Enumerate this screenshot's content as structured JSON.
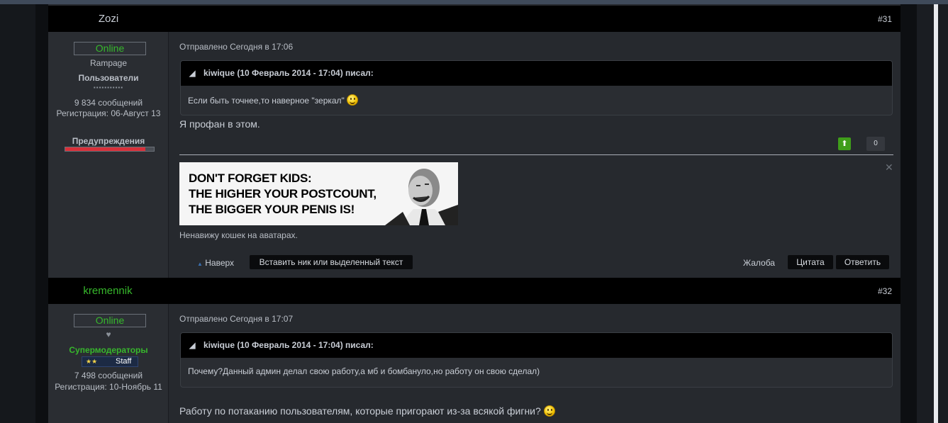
{
  "posts": [
    {
      "author": "Zozi",
      "author_color": "#c9ced6",
      "number": "#31",
      "status": "Online",
      "title": "Rampage",
      "group": "Пользователи",
      "pips": "▪▪▪▪▪▪▪▪▪▪▪",
      "messages": "9 834 сообщений",
      "registered": "Регистрация: 06-Август 13",
      "warnings_label": "Предупреждения",
      "warning_level": 0.9,
      "sent": "Отправлено Сегодня в 17:06",
      "quote_author": "kiwique (10 Февраль 2014 - 17:04) писал:",
      "quote_text": "Если быть точнее,то наверное \"зеркал\"",
      "text": "Я профан в этом.",
      "rep_count": "0",
      "signature_lines": [
        "DON'T FORGET KIDS:",
        "THE HIGHER YOUR POSTCOUNT,",
        "THE BIGGER YOUR PENIS IS!"
      ],
      "signature_caption": "Ненавижу кошек на аватарах.",
      "actions": {
        "top": "Наверх",
        "insert": "Вставить ник или выделенный текст",
        "report": "Жалоба",
        "quote": "Цитата",
        "reply": "Ответить"
      }
    },
    {
      "author": "kremennik",
      "author_color": "#37b82c",
      "number": "#32",
      "status": "Online",
      "title": "♥",
      "group": "Супермодераторы",
      "badge_stars": "★★",
      "badge": "Staff",
      "messages": "7 498 сообщений",
      "registered": "Регистрация: 10-Ноябрь 11",
      "sent": "Отправлено Сегодня в 17:07",
      "quote_author": "kiwique (10 Февраль 2014 - 17:04) писал:",
      "quote_text": "Почему?Данный админ делал свою работу,а мб и бомбануло,но работу он свою сделал)",
      "text": "Работу по потаканию пользователям, которые пригорают из-за всякой фигни?"
    }
  ]
}
